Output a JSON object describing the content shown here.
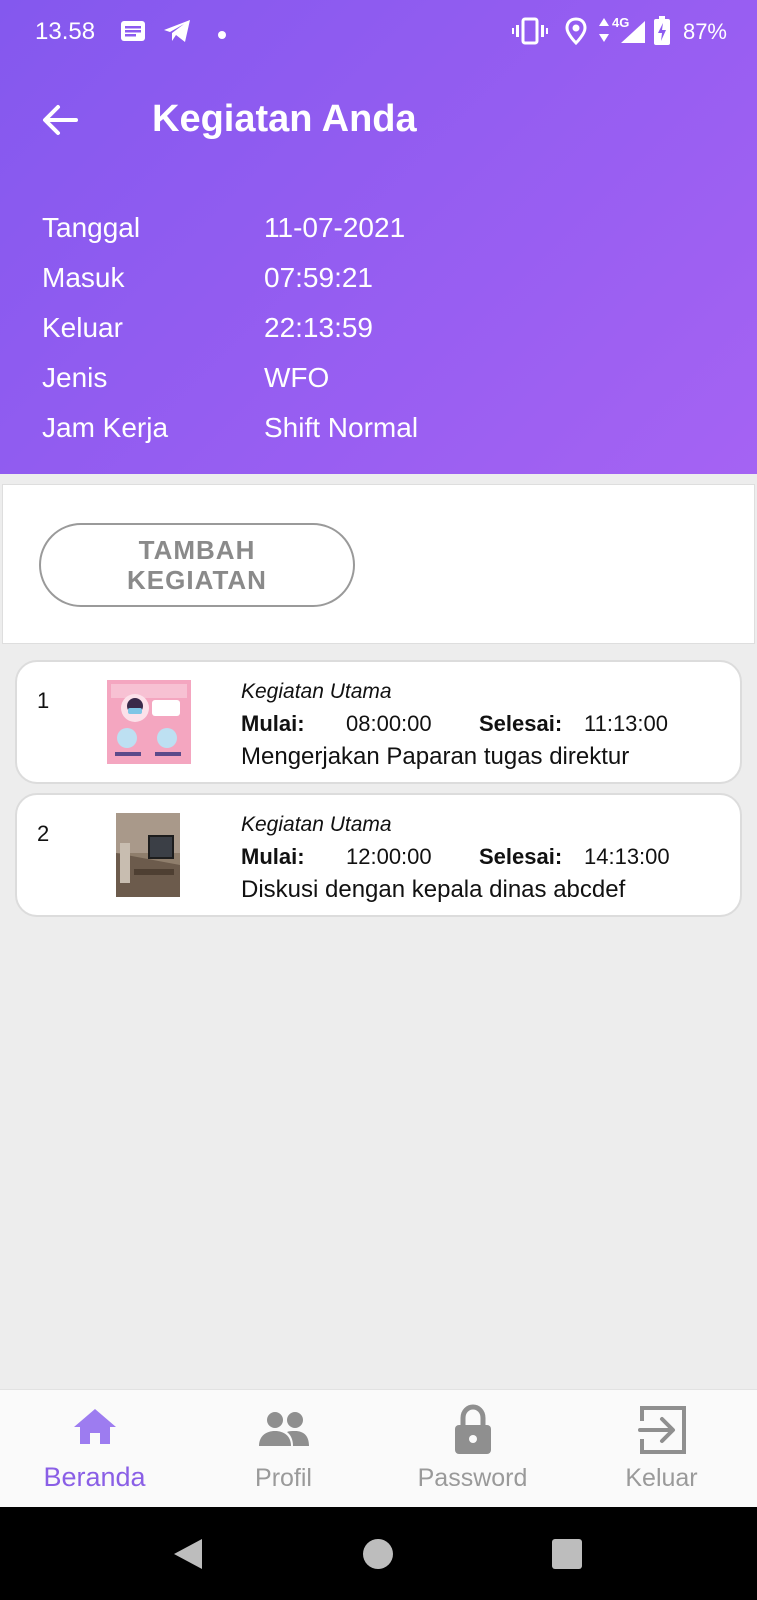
{
  "status_bar": {
    "time": "13.58",
    "network": "4G",
    "battery": "87%",
    "icons": [
      "message-icon",
      "telegram-icon",
      "dot-icon",
      "vibrate-icon",
      "location-icon",
      "data-arrows-icon",
      "signal-icon",
      "battery-charging-icon"
    ]
  },
  "header": {
    "title": "Kegiatan Anda",
    "back_icon": "arrow-left-icon",
    "info": [
      {
        "label": "Tanggal",
        "value": "11-07-2021"
      },
      {
        "label": "Masuk",
        "value": "07:59:21"
      },
      {
        "label": "Keluar",
        "value": "22:13:59"
      },
      {
        "label": "Jenis",
        "value": "WFO"
      },
      {
        "label": "Jam Kerja",
        "value": "Shift Normal"
      }
    ]
  },
  "actions": {
    "add_label": "TAMBAH KEGIATAN"
  },
  "activities": [
    {
      "no": "1",
      "type": "Kegiatan Utama",
      "start_label": "Mulai:",
      "start": "08:00:00",
      "end_label": "Selesai:",
      "end": "11:13:00",
      "description": "Mengerjakan Paparan tugas direktur",
      "thumb": "covid-poster-thumbnail"
    },
    {
      "no": "2",
      "type": "Kegiatan Utama",
      "start_label": "Mulai:",
      "start": "12:00:00",
      "end_label": "Selesai:",
      "end": "14:13:00",
      "description": "Diskusi dengan kepala dinas abcdef",
      "thumb": "room-photo-thumbnail"
    }
  ],
  "bottom_nav": [
    {
      "label": "Beranda",
      "icon": "home-icon",
      "active": true
    },
    {
      "label": "Profil",
      "icon": "people-icon",
      "active": false
    },
    {
      "label": "Password",
      "icon": "lock-icon",
      "active": false
    },
    {
      "label": "Keluar",
      "icon": "exit-icon",
      "active": false
    }
  ],
  "colors": {
    "header_bg": "#8c5bf0",
    "active_nav": "#8a5fe6",
    "inactive_nav": "#9a9a9a"
  }
}
